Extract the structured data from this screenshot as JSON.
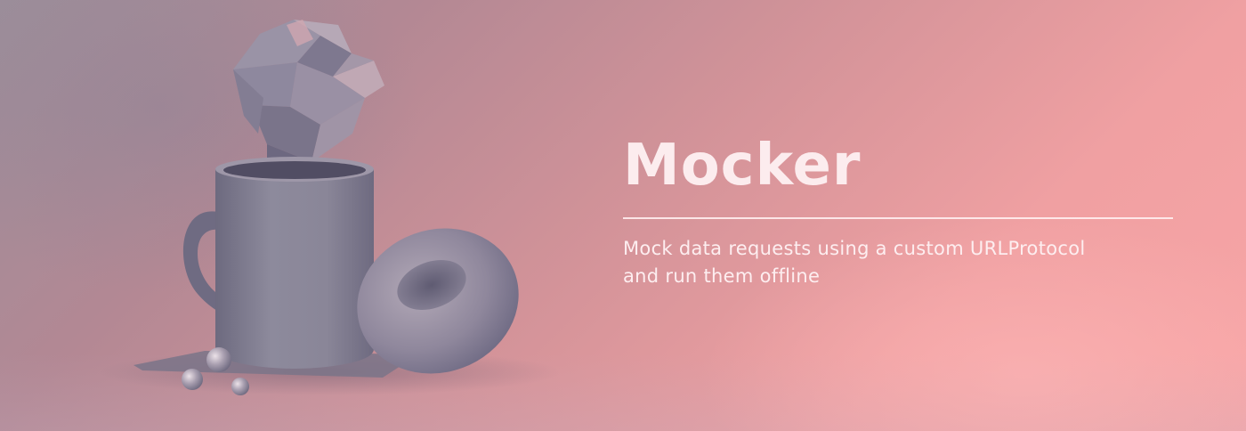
{
  "banner": {
    "title": "Mocker",
    "subtitle_line1": "Mock data requests using a custom URLProtocol",
    "subtitle_line2": "and run them offline"
  },
  "illustration": {
    "objects": [
      "low-poly-rock",
      "coffee-mug",
      "donut",
      "glass-spheres",
      "tray"
    ]
  },
  "colors": {
    "background_left": "#9c8e9a",
    "background_right": "#f8a5a6",
    "text": "#fcecee",
    "object_gray": "#7c7a8c"
  }
}
